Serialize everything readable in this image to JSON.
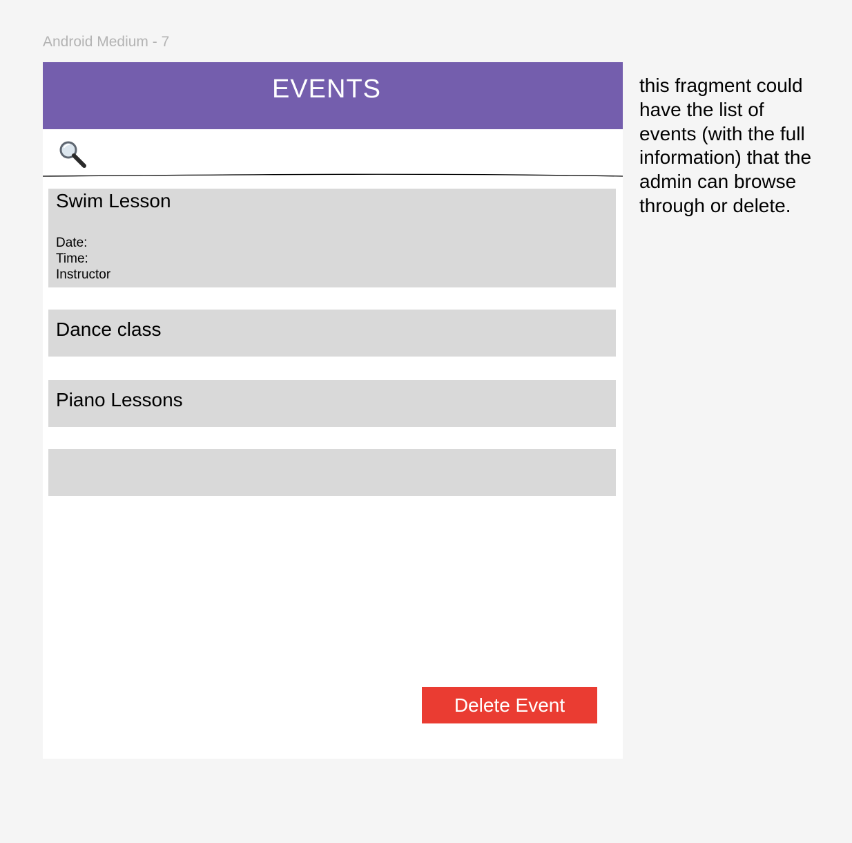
{
  "frame": {
    "label": "Android Medium - 7"
  },
  "app": {
    "title": "EVENTS",
    "header_color": "#745ead"
  },
  "search": {
    "icon": "magnifying-glass",
    "value": "",
    "placeholder": ""
  },
  "events": [
    {
      "title": "Swim Lesson",
      "details": {
        "date_label": "Date:",
        "time_label": "Time:",
        "instructor_label": "Instructor"
      }
    },
    {
      "title": "Dance class"
    },
    {
      "title": "Piano Lessons"
    },
    {
      "title": ""
    }
  ],
  "actions": {
    "delete_label": "Delete Event",
    "delete_color": "#ea3c32"
  },
  "annotation": {
    "text": "this fragment could have the list of events (with the full information) that the admin can browse through or delete."
  }
}
